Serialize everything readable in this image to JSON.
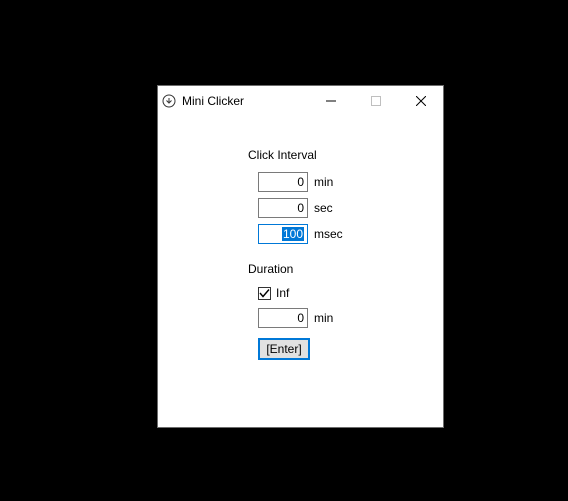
{
  "window": {
    "title": "Mini Clicker"
  },
  "interval": {
    "section_label": "Click Interval",
    "min_value": "0",
    "min_unit": "min",
    "sec_value": "0",
    "sec_unit": "sec",
    "msec_value": "100",
    "msec_unit": "msec"
  },
  "duration": {
    "section_label": "Duration",
    "inf_label": "Inf",
    "inf_checked": true,
    "min_value": "0",
    "min_unit": "min"
  },
  "action": {
    "enter_label": "[Enter]"
  }
}
